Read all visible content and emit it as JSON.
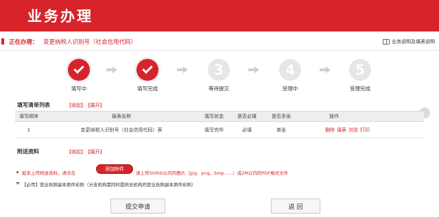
{
  "header": {
    "title": "业务办理"
  },
  "infobar": {
    "doing_label": "正在办理：",
    "doing_value": "变更纳税人识别号（社会信用代码）",
    "help_link": "业务说明及填表说明"
  },
  "steps": [
    {
      "number": "1",
      "label": "填写中",
      "status": "done"
    },
    {
      "number": "2",
      "label": "填写完成",
      "status": "done"
    },
    {
      "number": "3",
      "label": "等待提交",
      "status": "pending"
    },
    {
      "number": "4",
      "label": "受理中",
      "status": "pending"
    },
    {
      "number": "5",
      "label": "受理完成",
      "status": "pending"
    }
  ],
  "fill_list": {
    "title": "填写清单列表",
    "collapse": "【收起】",
    "expand": "【展开】",
    "columns": [
      "填写顺序",
      "报表名称",
      "填写状态",
      "是否必填",
      "是否多张",
      "操作"
    ],
    "rows": [
      {
        "order": "1",
        "name": "变更纳税人识别号（社会信用代码）表",
        "status": "填写完毕",
        "required": "必填",
        "multiple": "单张",
        "ops": [
          "删除",
          "填表",
          "浏览",
          "打印"
        ]
      }
    ]
  },
  "attachments": {
    "title": "附送资料",
    "collapse": "【收起】",
    "expand": "【展开】",
    "line1_pre": "如未上传附送资料，请点击",
    "add_button": "添加附件",
    "line1_post": "请上传500kb以内的图片（jpg、png、bmp......）或2M以内的PDF格式文件",
    "line2": "【必传】营业执照副本原件彩照（分支机构需同时提供总机构的营业执照副本原件彩照）"
  },
  "buttons": {
    "submit": "提交申请",
    "back": "返 回"
  },
  "colors": {
    "brand_red": "#d7242a"
  }
}
